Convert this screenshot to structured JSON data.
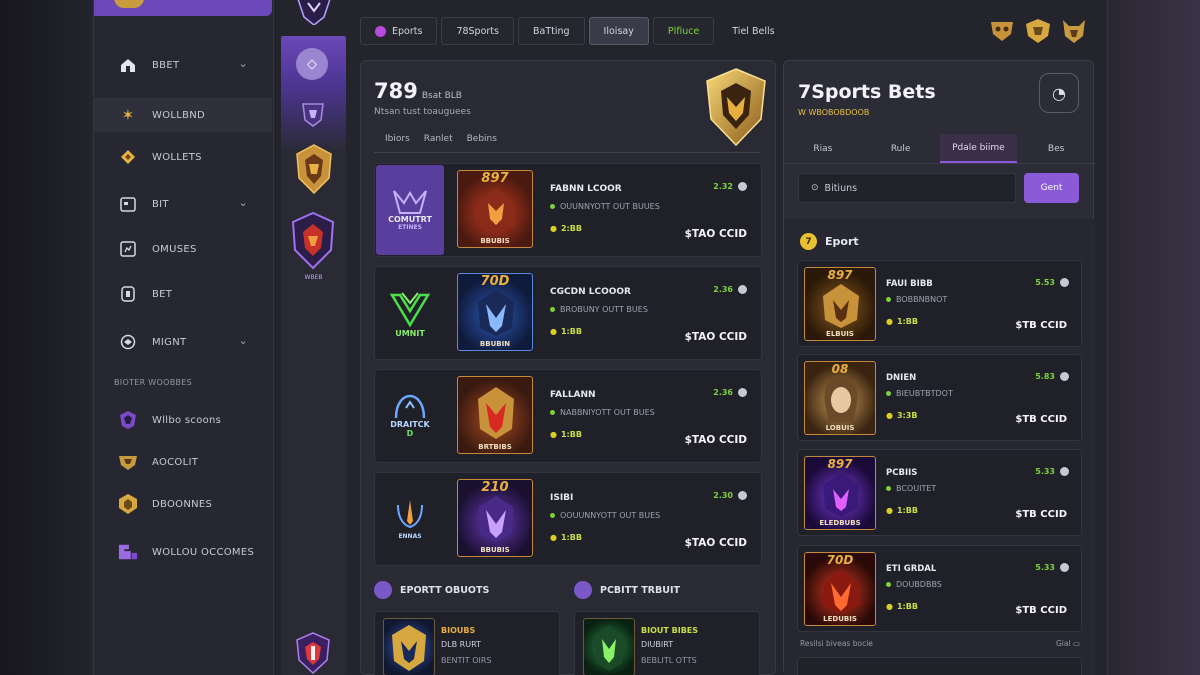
{
  "sidebar": {
    "items": [
      {
        "label": "BBET",
        "icon": "home-icon",
        "chev": "⌄"
      },
      {
        "label": "WOLLBND",
        "icon": "star-icon"
      },
      {
        "label": "WOLLETS",
        "icon": "diamond-icon"
      },
      {
        "label": "BIT",
        "icon": "calendar-icon",
        "chev": "⌄"
      },
      {
        "label": "OMUSES",
        "icon": "grid-icon"
      },
      {
        "label": "BET",
        "icon": "ticket-icon"
      },
      {
        "label": "MIGNT",
        "icon": "globe-icon",
        "chev": "⌄"
      }
    ],
    "section_title": "BIOTER WOOBBES",
    "games": [
      {
        "label": "Wllbo scoons",
        "icon": "purple-crest-icon"
      },
      {
        "label": "AOCOLIT",
        "icon": "gold-crest-icon"
      },
      {
        "label": "DBOONNES",
        "icon": "gold-badge-icon"
      },
      {
        "label": "WOLLOU OCCOMES",
        "icon": "purple-block-icon"
      }
    ]
  },
  "strip": {
    "badge": "WBEB"
  },
  "top_tabs": [
    {
      "label": "Eports",
      "state": "default"
    },
    {
      "label": "78Sports",
      "state": "default"
    },
    {
      "label": "BaTting",
      "state": "default"
    },
    {
      "label": "Iloisay",
      "state": "selected"
    },
    {
      "label": "Plfiuce",
      "state": "green"
    },
    {
      "label": "Tiel Bells",
      "state": "default"
    }
  ],
  "main": {
    "title": "789",
    "title_small": "Bsat BLB",
    "subtitle": "Ntsan tust toauguees",
    "subtabs": [
      "Ibiors",
      "Ranlet",
      "Bebins"
    ],
    "cards": [
      {
        "team": "COMUTRT",
        "team_sub": "ETINES",
        "num": "897",
        "cap": "BBUBIS",
        "name": "FABNN LCOOR",
        "meta": "OUUNNYOTT OUT BUUES",
        "odds": "2:BB",
        "live": "2.32",
        "price": "$TAO CCID"
      },
      {
        "team": "UMNIT",
        "team_sub": "",
        "num": "70D",
        "cap": "BBUBIN",
        "name": "CGCDN LCOOOR",
        "meta": "BROBUNY OUTT BUES",
        "odds": "1:BB",
        "live": "2.36",
        "price": "$TAO CCID"
      },
      {
        "team": "DRAITCK",
        "team_sub": "D",
        "num": "",
        "cap": "BRTBIBS",
        "name": "FALLANN",
        "meta": "NABBNIYOTT OUT BUES",
        "odds": "1:BB",
        "live": "2.36",
        "price": "$TAO CCID"
      },
      {
        "team": "ENNAS",
        "team_sub": "",
        "num": "210",
        "cap": "BBUBIS",
        "name": "ISIBI",
        "meta": "OOUUNNYOTT OUT BUES",
        "odds": "1:BB",
        "live": "2.30",
        "price": "$TAO CCID"
      }
    ],
    "sections": [
      {
        "title": "EPORTT OBUOTS"
      },
      {
        "title": "PCBITT TRBUIT"
      }
    ],
    "minis": [
      {
        "l1": "BIOUBS",
        "l2": "DLB RURT",
        "l3": "BENTIT OIRS"
      },
      {
        "l1": "BIOUT BIBES",
        "l2": "DIUBIRT",
        "l3": "BEBLITL OTTS"
      }
    ]
  },
  "right": {
    "title": "7Sports Bets",
    "subtitle": "W WBOBOBDOOB",
    "tabs": [
      "Rias",
      "Rule",
      "Pdale biime",
      "Bes"
    ],
    "search_value": "Bitiuns",
    "go_label": "Gent",
    "section": "Eport",
    "section_badge": "7",
    "cards": [
      {
        "num": "897",
        "cap": "ELBUIS",
        "name": "FAUI BIBB",
        "meta": "BOBBNBNOT",
        "odds": "1:BB",
        "live": "5.53",
        "price": "$TB CCID"
      },
      {
        "num": "08",
        "cap": "LOBUIS",
        "name": "DNIEN",
        "meta": "BIEUBTBTDOT",
        "odds": "3:3B",
        "live": "5.83",
        "price": "$TB CCID"
      },
      {
        "num": "897",
        "cap": "ELEDBUBS",
        "name": "PCBIIS",
        "meta": "BCOUITET",
        "odds": "1:BB",
        "live": "5.33",
        "price": "$TB CCID"
      },
      {
        "num": "70D",
        "cap": "LEDUBIS",
        "name": "ETI GRDAL",
        "meta": "DOUBDBBS",
        "odds": "1:BB",
        "live": "5.33",
        "price": "$TB CCID"
      }
    ],
    "footer_left": "Resilsi biveas bocie",
    "footer_right": "Gial"
  },
  "colors": {
    "accent": "#8a5ad8",
    "gold": "#e8b040",
    "green": "#7dd13a",
    "bg": "#23242c"
  }
}
